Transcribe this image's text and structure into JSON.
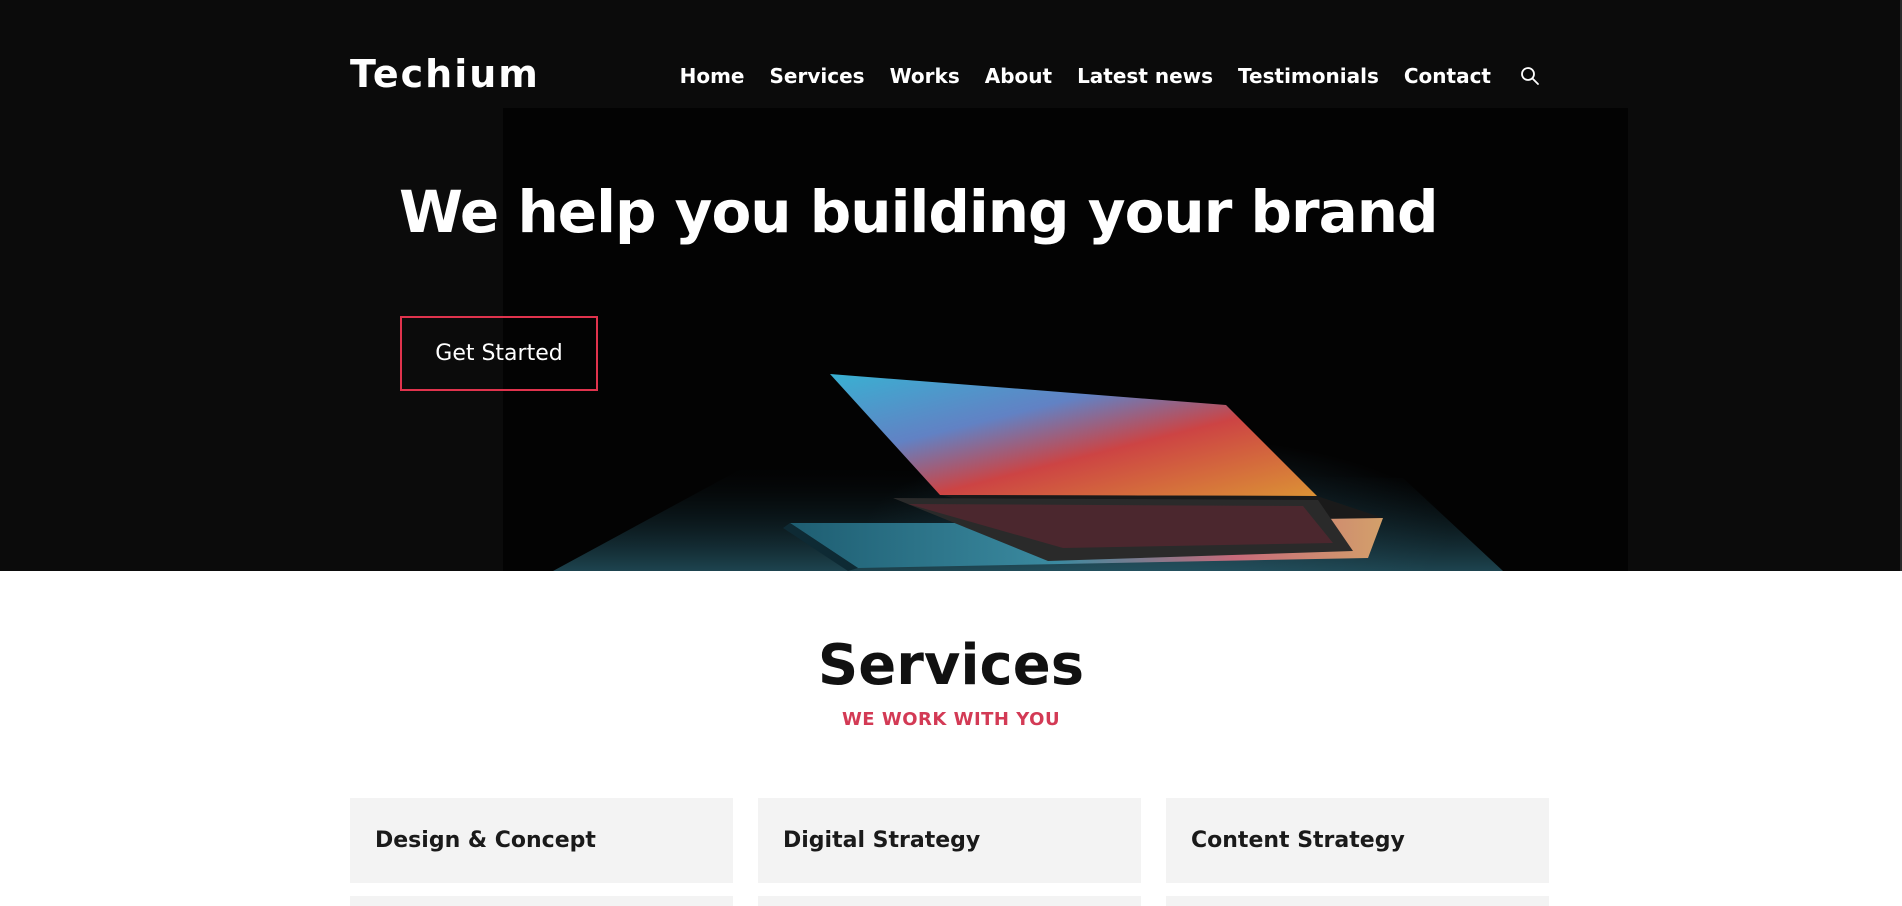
{
  "header": {
    "logo": "Techium",
    "nav": [
      "Home",
      "Services",
      "Works",
      "About",
      "Latest news",
      "Testimonials",
      "Contact"
    ],
    "search_icon": "search-icon"
  },
  "hero": {
    "title": "We help you building your brand",
    "cta_label": "Get Started",
    "accent_color": "#e0334d"
  },
  "services": {
    "title": "Services",
    "subtitle": "WE WORK WITH YOU",
    "cards": [
      "Design & Concept",
      "Digital Strategy",
      "Content Strategy"
    ]
  }
}
